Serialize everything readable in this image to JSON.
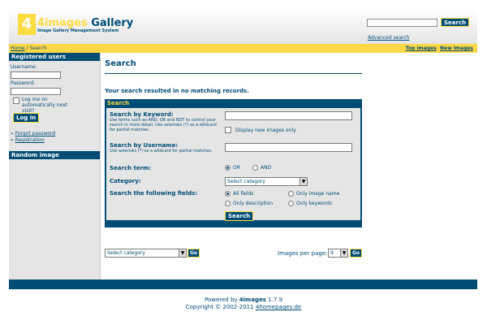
{
  "header": {
    "logo_mark": "4",
    "logo_name_a": "4images",
    "logo_name_b": "Gallery",
    "logo_sub": "Image Gallery Management System",
    "search_button": "Search",
    "advanced_search": "Advanced search"
  },
  "navbar": {
    "home": "Home",
    "separator": " / ",
    "current": "Search",
    "top_images": "Top images",
    "new_images": "New images"
  },
  "sidebar": {
    "registered_heading": "Registered users",
    "username_label": "Username:",
    "password_label": "Password:",
    "remember_label": "Log me on automatically next visit?",
    "login_button": "Log in",
    "forgot_password": "Forgot password",
    "registration": "Registration",
    "random_heading": "Random image"
  },
  "main": {
    "title": "Search",
    "message": "Your search resulted in no matching records.",
    "panel_title": "Search",
    "keyword_label": "Search by Keyword:",
    "keyword_hint": "Use terms such as AND, OR and NOT to control your search in more detail. Use asterisks (*) as a wildcard for partial matches.",
    "new_only": "Display new images only",
    "username_label": "Search by Username:",
    "username_hint": "Use asterisks (*) as a wildcard for partial matches.",
    "term_label": "Search term:",
    "term_or": "OR",
    "term_and": "AND",
    "category_label": "Category:",
    "category_value": "Select category",
    "fields_label": "Search the following fields:",
    "fields_all": "All fields",
    "fields_name": "Only image name",
    "fields_desc": "Only description",
    "fields_keywords": "Only keywords",
    "search_button": "Search",
    "bottom_category": "Select category",
    "go": "Go",
    "per_page_label": "Images per page:",
    "per_page_value": "9"
  },
  "footer": {
    "powered_prefix": "Powered by ",
    "powered_name": "4images",
    "powered_version": " 1.7.9",
    "copyright_prefix": "Copyright © 2002-2011 ",
    "copyright_link": "4homepages.de"
  },
  "colors": {
    "brand_blue": "#004c75",
    "brand_yellow": "#fcdc43",
    "panel_grey": "#e5e5e5"
  }
}
